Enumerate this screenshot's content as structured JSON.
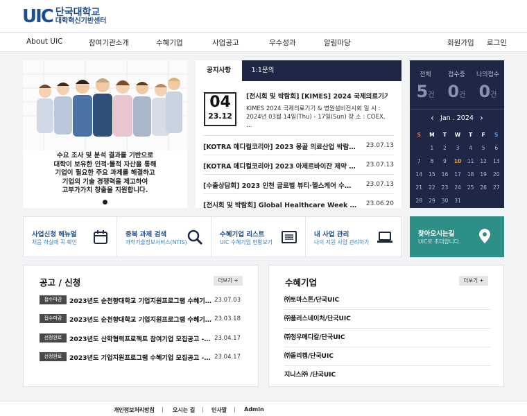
{
  "logo": {
    "mark": "UIC",
    "line1": "단국대학교",
    "line2": "대학혁신기반센터"
  },
  "nav": {
    "items": [
      "About UIC",
      "참여기관소개",
      "수혜기업",
      "사업공고",
      "우수성과",
      "알림마당"
    ],
    "join": "회원가입",
    "login": "로그인"
  },
  "hero": {
    "caption": [
      "수요 조사 및 분석 결과를 기반으로",
      "대학이 보유한 인적·물적 자산을 통해",
      "기업이 필요한 주요 과제를 해결하고",
      "기업의 기술 경쟁력을 제고하여",
      "고부가가치 창출을 지원합니다."
    ]
  },
  "notice": {
    "tabs": [
      "공지사항",
      "1:1문의"
    ],
    "featured": {
      "day": "04",
      "ym": "23.12",
      "title": "[전시회 및 박람회] [KIMES] 2024 국제의료기기 …",
      "body": [
        "KIMES 2024 국제의료기기 & 병원설비전시회 일 시 :",
        "2024년 03월 14일(Thu) - 17일(Sun) 장 소 : COEX,",
        "…"
      ]
    },
    "items": [
      {
        "title": "[KOTRA 메디컬코리아] 2023 몽골 의료산업 박람회 연계…",
        "date": "23.07.13"
      },
      {
        "title": "[KOTRA 메디컬코리아] 2023 아제르바이잔 제약 의료기…",
        "date": "23.07.13"
      },
      {
        "title": "[수출상담회] 2023 인천 글로벌 뷰티·헬스케어 수출상…",
        "date": "23.07.13"
      },
      {
        "title": "[전시회 및 박람회] Global Healthcare Week 2023 (202…",
        "date": "23.06.20"
      }
    ]
  },
  "stats": {
    "items": [
      {
        "label": "전체",
        "value": "5",
        "unit": "건"
      },
      {
        "label": "접수중",
        "value": "0",
        "unit": "건"
      },
      {
        "label": "나의접수",
        "value": "0",
        "unit": "건"
      }
    ]
  },
  "calendar": {
    "month": "Jan . 2024",
    "prev": "‹",
    "next": "›",
    "weekdays": [
      "S",
      "M",
      "T",
      "W",
      "T",
      "F",
      "S"
    ],
    "weeks": [
      [
        "",
        "1",
        "2",
        "3",
        "4",
        "5",
        "6"
      ],
      [
        "7",
        "8",
        "9",
        "10",
        "11",
        "12",
        "13"
      ],
      [
        "14",
        "15",
        "16",
        "17",
        "18",
        "19",
        "20"
      ],
      [
        "21",
        "22",
        "23",
        "24",
        "25",
        "26",
        "27"
      ],
      [
        "28",
        "29",
        "30",
        "31",
        "",
        "",
        ""
      ]
    ],
    "today": "10"
  },
  "quick": [
    {
      "title": "사업신청 헤뉴얼",
      "sub": "처음 하실때 꼭 확인",
      "icon": "calendar-icon"
    },
    {
      "title": "중복 과제 검색",
      "sub": "과학기술정보서비스(NTIS)",
      "icon": "search-icon"
    },
    {
      "title": "수혜기업 리스트",
      "sub": "UIC 수혜기업 현황보기",
      "icon": "list-icon"
    },
    {
      "title": "내 사업 관리",
      "sub": "나의 지원 사업 관리하기",
      "icon": "laptop-icon"
    }
  ],
  "location": {
    "title": "찾아오시는길",
    "sub": "UIC로 초대합니다.",
    "icon": "map-pin-icon"
  },
  "announcements": {
    "title": "공고 / 신청",
    "more": "더보기 +",
    "items": [
      {
        "badge": "접수마감",
        "title": "2023년도 순천향대학교 기업지원프로그램 수혜기업 …",
        "date": "23.07.03"
      },
      {
        "badge": "접수마감",
        "title": "2023년도 순천향대학교 기업지원프로그램 수혜기업 …",
        "date": "23.03.18"
      },
      {
        "badge": "선정완료",
        "title": "2023년도 산학협력프로젝트 참여기업 모집공고 - 단…",
        "date": "23.04.17"
      },
      {
        "badge": "선정완료",
        "title": "2023년도 기업지원프로그램 수혜기업 모집공고 - 단…",
        "date": "23.04.17"
      }
    ]
  },
  "companies": {
    "title": "수혜기업",
    "more": "더보기 +",
    "items": [
      "㈜토마스톤/단국UIC",
      "㈜플러스네이처/단국UIC",
      "㈜청우메디칼/단국UIC",
      "㈜돌리켐/단국UIC",
      "지니스㈜ /단국UIC"
    ]
  },
  "footer": {
    "links": [
      "개인정보처리방침",
      "오시는 길",
      "인사말",
      "Admin"
    ]
  }
}
